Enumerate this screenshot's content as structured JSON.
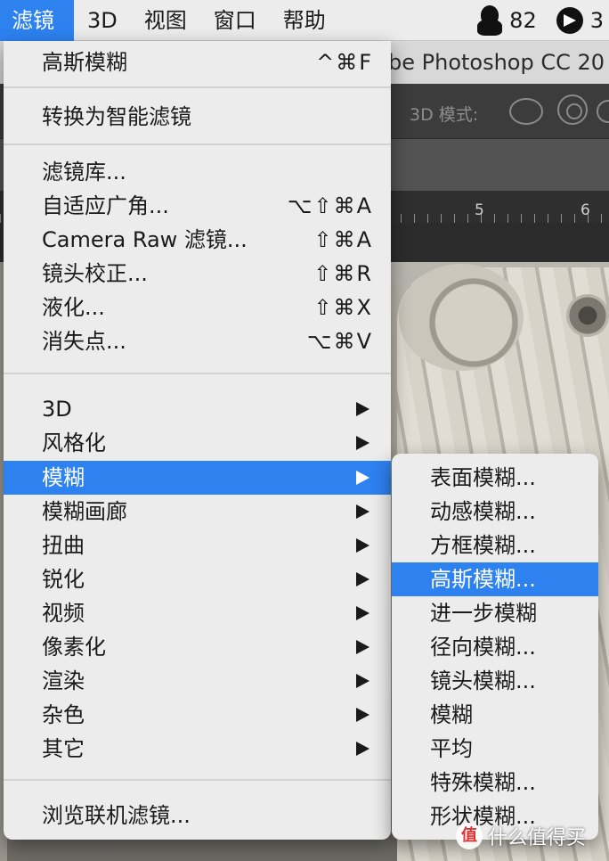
{
  "menubar": {
    "items": [
      "滤镜",
      "3D",
      "视图",
      "窗口",
      "帮助"
    ],
    "qq_count": "82",
    "right_count": "3"
  },
  "photoshop": {
    "title_fragment": "be Photoshop CC 20",
    "options_label": "3D 模式:",
    "ruler_labels": [
      "5",
      "6"
    ]
  },
  "filter_menu": {
    "items": [
      {
        "label": "高斯模糊",
        "shortcut": "^⌘F"
      },
      {
        "label": "转换为智能滤镜",
        "shortcut": ""
      },
      {
        "label": "滤镜库...",
        "shortcut": ""
      },
      {
        "label": "自适应广角...",
        "shortcut": "⌥⇧⌘A"
      },
      {
        "label": "Camera Raw 滤镜...",
        "shortcut": "⇧⌘A"
      },
      {
        "label": "镜头校正...",
        "shortcut": "⇧⌘R"
      },
      {
        "label": "液化...",
        "shortcut": "⇧⌘X"
      },
      {
        "label": "消失点...",
        "shortcut": "⌥⌘V"
      },
      {
        "label": "3D",
        "submenu": true
      },
      {
        "label": "风格化",
        "submenu": true
      },
      {
        "label": "模糊",
        "submenu": true,
        "highlighted": true
      },
      {
        "label": "模糊画廊",
        "submenu": true
      },
      {
        "label": "扭曲",
        "submenu": true
      },
      {
        "label": "锐化",
        "submenu": true
      },
      {
        "label": "视频",
        "submenu": true
      },
      {
        "label": "像素化",
        "submenu": true
      },
      {
        "label": "渲染",
        "submenu": true
      },
      {
        "label": "杂色",
        "submenu": true
      },
      {
        "label": "其它",
        "submenu": true
      },
      {
        "label": "浏览联机滤镜..."
      }
    ]
  },
  "blur_submenu": {
    "items": [
      "表面模糊...",
      "动感模糊...",
      "方框模糊...",
      "高斯模糊...",
      "进一步模糊",
      "径向模糊...",
      "镜头模糊...",
      "模糊",
      "平均",
      "特殊模糊...",
      "形状模糊..."
    ],
    "highlighted": "高斯模糊..."
  },
  "watermark": {
    "badge": "值",
    "text": "什么值得买"
  },
  "colors": {
    "highlight": "#2d82f0",
    "menu_bg": "#ececec",
    "menubar_bg": "#ececec"
  }
}
